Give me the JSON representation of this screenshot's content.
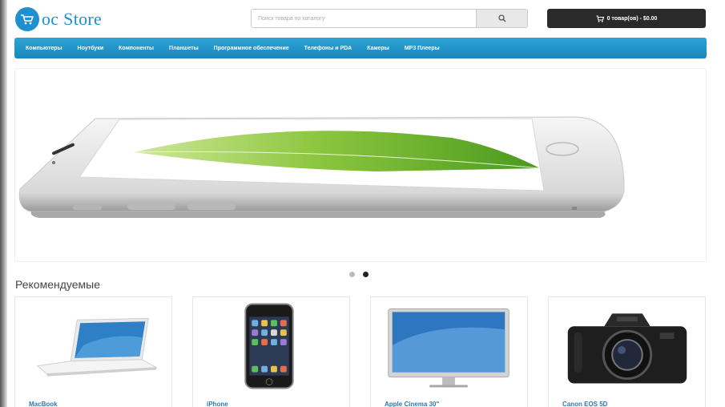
{
  "header": {
    "logo_text": "oc Store",
    "search": {
      "placeholder": "Поиск товара по каталогу"
    },
    "cart_label": "0 товар(ов) - $0.00"
  },
  "menu": {
    "items": [
      "Компьютеры",
      "Ноутбуки",
      "Компоненты",
      "Планшеты",
      "Программное обеспечение",
      "Телефоны и PDA",
      "Камеры",
      "MP3 Плееры"
    ]
  },
  "slideshow": {
    "dots": 2,
    "active_index": 1
  },
  "featured": {
    "title": "Рекомендуемые",
    "products": [
      {
        "name": "MacBook"
      },
      {
        "name": "iPhone"
      },
      {
        "name": "Apple Cinema 30\""
      },
      {
        "name": "Canon EOS 5D"
      }
    ]
  },
  "colors": {
    "accent": "#1e8fcf",
    "menu_bar": "#2196c9",
    "cart_bg": "#2a2a2a",
    "product_link": "#2a79b5"
  },
  "icons": [
    "cart-logo-icon",
    "search-icon",
    "cart-icon"
  ]
}
